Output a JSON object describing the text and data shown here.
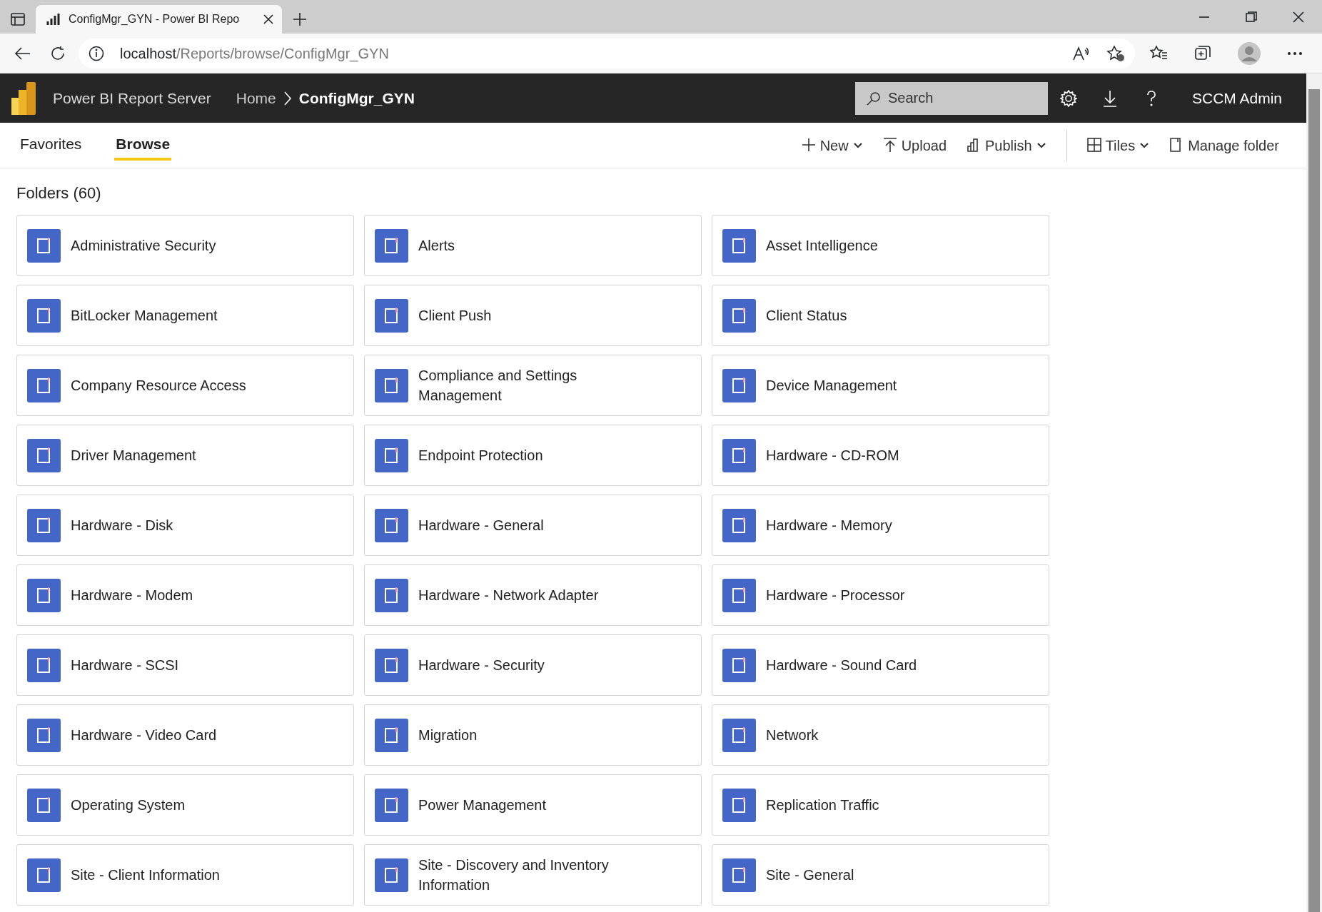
{
  "browser": {
    "tab_title": "ConfigMgr_GYN - Power BI Repo",
    "address_host": "localhost",
    "address_path": "/Reports/browse/ConfigMgr_GYN"
  },
  "header": {
    "app_name": "Power BI Report Server",
    "breadcrumbs": [
      {
        "label": "Home",
        "current": false
      },
      {
        "label": "ConfigMgr_GYN",
        "current": true
      }
    ],
    "search": {
      "placeholder": "Search"
    },
    "user": "SCCM Admin"
  },
  "nav_tabs": [
    {
      "label": "Favorites",
      "selected": false
    },
    {
      "label": "Browse",
      "selected": true
    }
  ],
  "toolbar": [
    {
      "kind": "new",
      "label": "New",
      "dropdown": true
    },
    {
      "kind": "upload",
      "label": "Upload",
      "dropdown": false
    },
    {
      "kind": "publish",
      "label": "Publish",
      "dropdown": true
    },
    {
      "kind": "tiles",
      "label": "Tiles",
      "dropdown": true
    },
    {
      "kind": "manage",
      "label": "Manage folder",
      "dropdown": false
    }
  ],
  "folders_title": "Folders (60)",
  "folder_rows": [
    {
      "folders": [
        "Administrative Security",
        "Alerts",
        "Asset Intelligence"
      ]
    },
    {
      "folders": [
        "BitLocker Management",
        "Client Push",
        "Client Status"
      ]
    },
    {
      "folders": [
        "Company Resource Access",
        "Compliance and Settings Management",
        "Device Management"
      ]
    },
    {
      "folders": [
        "Driver Management",
        "Endpoint Protection",
        "Hardware - CD-ROM"
      ]
    },
    {
      "folders": [
        "Hardware - Disk",
        "Hardware - General",
        "Hardware - Memory"
      ]
    },
    {
      "folders": [
        "Hardware - Modem",
        "Hardware - Network Adapter",
        "Hardware - Processor"
      ]
    },
    {
      "folders": [
        "Hardware - SCSI",
        "Hardware - Security",
        "Hardware - Sound Card"
      ]
    },
    {
      "folders": [
        "Hardware - Video Card",
        "Migration",
        "Network"
      ]
    },
    {
      "folders": [
        "Operating System",
        "Power Management",
        "Replication Traffic"
      ]
    },
    {
      "folders": [
        "Site - Client Information",
        "Site - Discovery and Inventory Information",
        "Site - General"
      ]
    }
  ]
}
